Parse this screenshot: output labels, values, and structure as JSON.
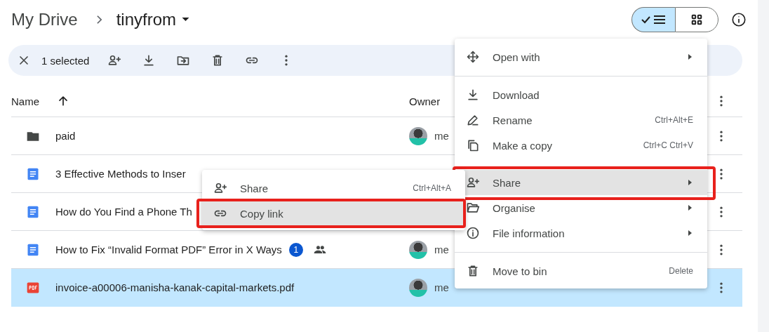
{
  "breadcrumb": {
    "root": "My Drive",
    "folder": "tinyfrom"
  },
  "view_toggle": [
    {
      "kind": "list",
      "selected": true
    },
    {
      "kind": "grid",
      "selected": false
    }
  ],
  "toolbar": {
    "count": "1 selected"
  },
  "columns": [
    {
      "label": "Name",
      "sorted": true
    },
    {
      "label": "Owner",
      "sorted": false
    }
  ],
  "rows": [
    {
      "kind": "folder",
      "name": "paid",
      "owner": "me",
      "selected": false
    },
    {
      "kind": "doc",
      "name": "3 Effective Methods to Inser",
      "selected": false
    },
    {
      "kind": "doc",
      "name": "How do You Find a Phone Th",
      "selected": false
    },
    {
      "kind": "doc",
      "name": "How to Fix “Invalid Format PDF” Error in X Ways",
      "badge": "1",
      "shared": true,
      "owner": "me",
      "selected": false
    },
    {
      "kind": "pdf",
      "name": "invoice-a00006-manisha-kanak-capital-markets.pdf",
      "owner": "me",
      "selected": true
    }
  ],
  "context_menu": {
    "items": [
      {
        "kind": "item",
        "label": "Open with",
        "submenu": true,
        "highlighted": false,
        "outlined": false
      },
      {
        "kind": "divider"
      },
      {
        "kind": "item",
        "label": "Download",
        "highlighted": false,
        "outlined": false
      },
      {
        "kind": "item",
        "label": "Rename",
        "shortcut": "Ctrl+Alt+E",
        "highlighted": false,
        "outlined": false
      },
      {
        "kind": "item",
        "label": "Make a copy",
        "shortcut": "Ctrl+C Ctrl+V",
        "highlighted": false,
        "outlined": false
      },
      {
        "kind": "item",
        "label": "Share",
        "submenu": true,
        "highlighted": true,
        "outlined": true
      },
      {
        "kind": "item",
        "label": "Organise",
        "submenu": true,
        "highlighted": false,
        "outlined": false
      },
      {
        "kind": "item",
        "label": "File information",
        "submenu": true,
        "highlighted": false,
        "outlined": false
      },
      {
        "kind": "divider"
      },
      {
        "kind": "item",
        "label": "Move to bin",
        "shortcut": "Delete",
        "highlighted": false,
        "outlined": false
      }
    ]
  },
  "share_submenu": {
    "items": [
      {
        "kind": "item",
        "label": "Share",
        "shortcut": "Ctrl+Alt+A",
        "highlighted": false,
        "outlined": false
      },
      {
        "kind": "item",
        "label": "Copy link",
        "highlighted": true,
        "outlined": true
      }
    ]
  }
}
